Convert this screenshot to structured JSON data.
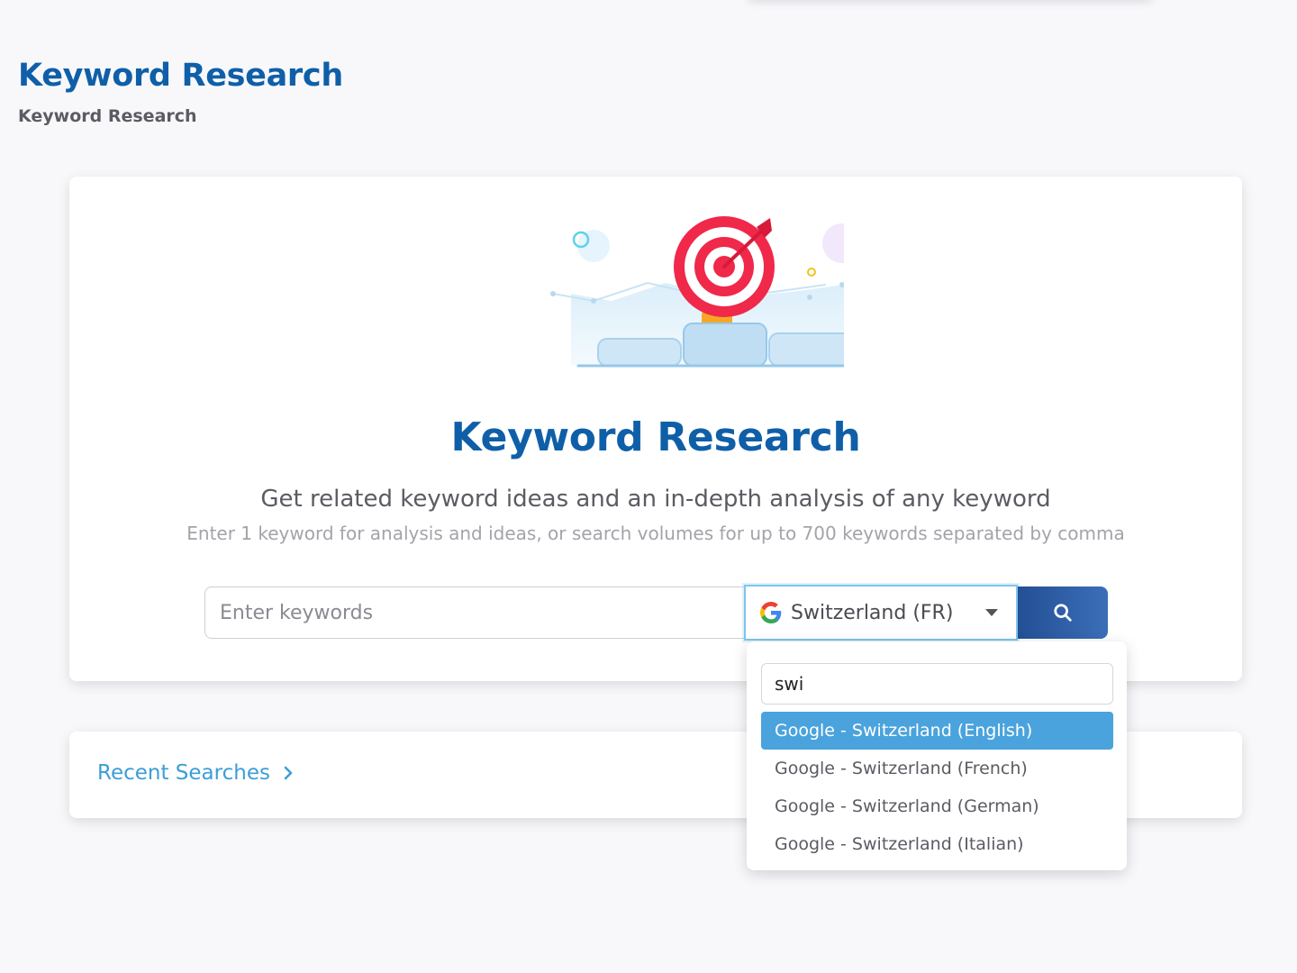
{
  "page": {
    "title": "Keyword Research",
    "breadcrumb": "Keyword Research"
  },
  "hero": {
    "title": "Keyword Research",
    "subtitle": "Get related keyword ideas and an in-depth analysis of any keyword",
    "helper": "Enter 1 keyword for analysis and ideas, or search volumes for up to 700 keywords separated by comma"
  },
  "search": {
    "placeholder": "Enter keywords",
    "value": "",
    "country_selected": "Switzerland (FR)",
    "search_icon": "search-icon",
    "engine_icon": "google-icon"
  },
  "dropdown": {
    "filter_value": "swi",
    "options": [
      {
        "label": "Google - Switzerland (English)",
        "highlighted": true
      },
      {
        "label": "Google - Switzerland (French)",
        "highlighted": false
      },
      {
        "label": "Google - Switzerland (German)",
        "highlighted": false
      },
      {
        "label": "Google - Switzerland (Italian)",
        "highlighted": false
      }
    ]
  },
  "recent": {
    "label": "Recent Searches",
    "icon": "chevron-right-icon"
  },
  "colors": {
    "title_blue": "#0f5fa8",
    "link_blue": "#3b9ed8",
    "highlight": "#4aa3dd",
    "button_start": "#244f95",
    "button_end": "#3a6fb8",
    "target_red": "#f0284a"
  }
}
